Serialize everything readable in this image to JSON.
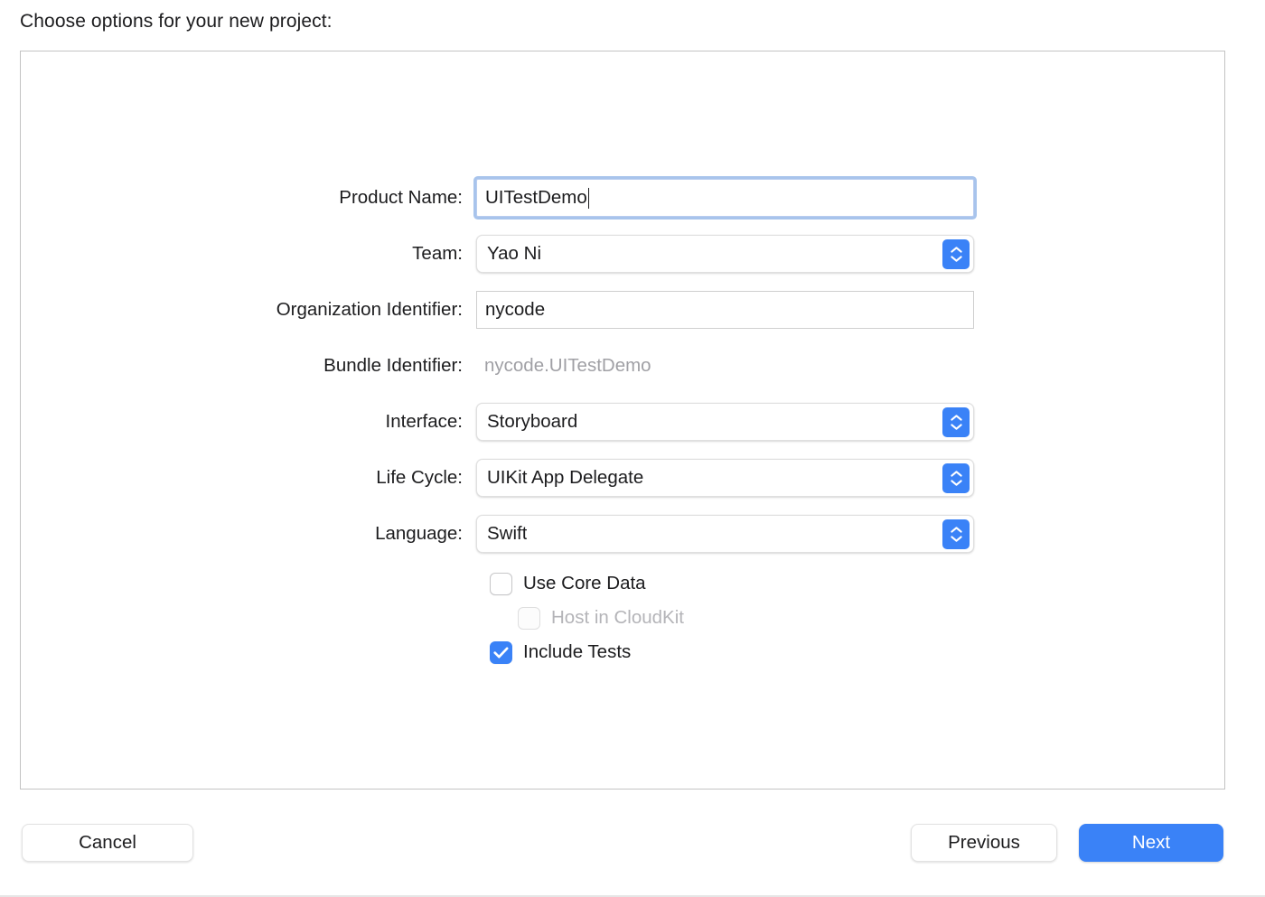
{
  "sheet": {
    "title": "Choose options for your new project:"
  },
  "form": {
    "rows": [
      {
        "label": "Product Name:",
        "type": "textfield",
        "value": "UITestDemo",
        "focused": true,
        "name": "product-name"
      },
      {
        "label": "Team:",
        "type": "popup",
        "value": "Yao Ni",
        "name": "team"
      },
      {
        "label": "Organization Identifier:",
        "type": "textfield",
        "value": "nycode",
        "focused": false,
        "name": "organization-identifier"
      },
      {
        "label": "Bundle Identifier:",
        "type": "static",
        "value": "nycode.UITestDemo",
        "name": "bundle-identifier"
      },
      {
        "label": "Interface:",
        "type": "popup",
        "value": "Storyboard",
        "name": "interface"
      },
      {
        "label": "Life Cycle:",
        "type": "popup",
        "value": "UIKit App Delegate",
        "name": "life-cycle"
      },
      {
        "label": "Language:",
        "type": "popup",
        "value": "Swift",
        "name": "language"
      }
    ]
  },
  "checkboxes": [
    {
      "label": "Use Core Data",
      "checked": false,
      "disabled": false,
      "indented": false,
      "name": "use-core-data"
    },
    {
      "label": "Host in CloudKit",
      "checked": false,
      "disabled": true,
      "indented": true,
      "name": "host-in-cloudkit"
    },
    {
      "label": "Include Tests",
      "checked": true,
      "disabled": false,
      "indented": false,
      "name": "include-tests"
    }
  ],
  "footer": {
    "cancel_label": "Cancel",
    "previous_label": "Previous",
    "next_label": "Next"
  },
  "colors": {
    "accent_blue": "#3a82f7",
    "focus_ring": "#a8c4ec",
    "panel_border": "#c3c3c3",
    "disabled_text": "#b4b4b8",
    "static_text": "#a0a0a5"
  }
}
